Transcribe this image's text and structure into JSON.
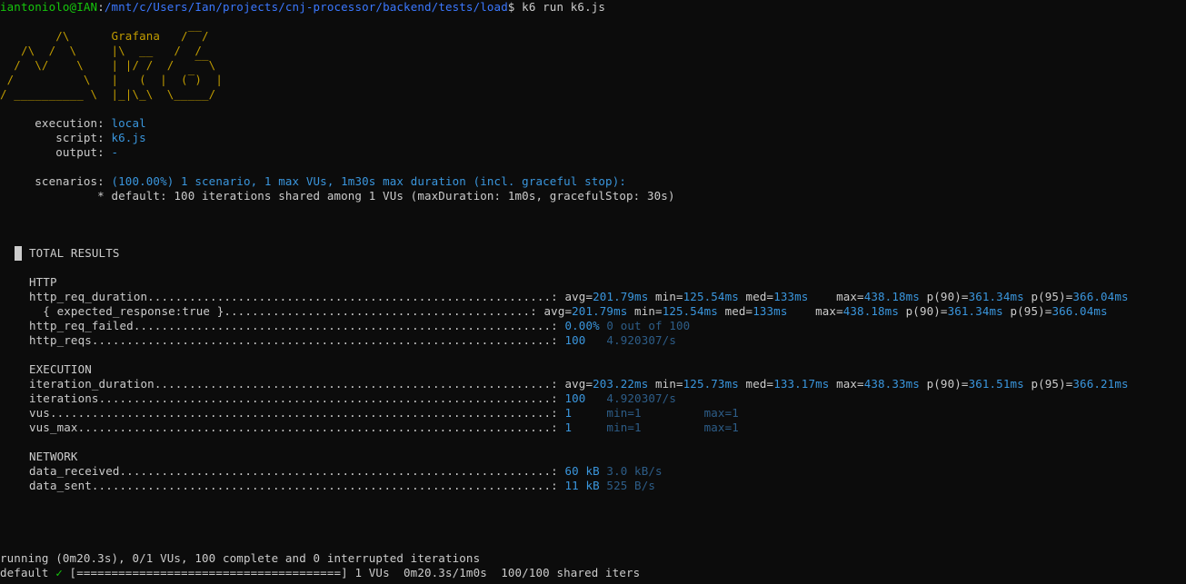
{
  "prompt": {
    "user": "iantoniolo@IAN",
    "colon": ":",
    "path": "/mnt/c/Users/Ian/projects/cnj-processor/backend/tests/load",
    "dollar": "$",
    "command": " k6 run k6.js"
  },
  "logo": {
    "lines": [
      "        /\\      Grafana   /‾‾/  ",
      "   /\\  /  \\     |\\  __   /  /   ",
      "  /  \\/    \\    | |/ /  /   ‾‾\\ ",
      " /          \\   |   (  |  (‾)  |",
      "/ __________ \\  |_|\\_\\  \\_____/ "
    ]
  },
  "config": {
    "execution_label": "     execution: ",
    "execution_value": "local",
    "script_label": "        script: ",
    "script_value": "k6.js",
    "output_label": "        output: ",
    "output_value": "-",
    "scenarios_label": "     scenarios: ",
    "scenarios_value": "(100.00%) 1 scenario, 1 max VUs, 1m30s max duration (incl. graceful stop):",
    "default_line": "              * default: 100 iterations shared among 1 VUs (maxDuration: 1m0s, gracefulStop: 30s)"
  },
  "results": {
    "title": "TOTAL RESULTS",
    "http_header": "HTTP",
    "execution_header": "EXECUTION",
    "network_header": "NETWORK",
    "http_req_duration": {
      "name": "http_req_duration",
      "dots": "..........................................................: ",
      "avg_k": "avg=",
      "avg_v": "201.79ms",
      "min_k": " min=",
      "min_v": "125.54ms",
      "med_k": " med=",
      "med_v": "133ms",
      "max_k": "    max=",
      "max_v": "438.18ms",
      "p90_k": " p(90)=",
      "p90_v": "361.34ms",
      "p95_k": " p(95)=",
      "p95_v": "366.04ms"
    },
    "expected_response": {
      "name": "  { expected_response:true }",
      "dots": "............................................: ",
      "avg_k": "avg=",
      "avg_v": "201.79ms",
      "min_k": " min=",
      "min_v": "125.54ms",
      "med_k": " med=",
      "med_v": "133ms",
      "max_k": "    max=",
      "max_v": "438.18ms",
      "p90_k": " p(90)=",
      "p90_v": "361.34ms",
      "p95_k": " p(95)=",
      "p95_v": "366.04ms"
    },
    "http_req_failed": {
      "name": "http_req_failed",
      "dots": "............................................................: ",
      "value": "0.00%",
      "extra": " 0 out of 100"
    },
    "http_reqs": {
      "name": "http_reqs",
      "dots": "..................................................................: ",
      "value": "100",
      "extra": "   4.920307/s"
    },
    "iteration_duration": {
      "name": "iteration_duration",
      "dots": ".........................................................: ",
      "avg_k": "avg=",
      "avg_v": "203.22ms",
      "min_k": " min=",
      "min_v": "125.73ms",
      "med_k": " med=",
      "med_v": "133.17ms",
      "max_k": " max=",
      "max_v": "438.33ms",
      "p90_k": " p(90)=",
      "p90_v": "361.51ms",
      "p95_k": " p(95)=",
      "p95_v": "366.21ms"
    },
    "iterations": {
      "name": "iterations",
      "dots": ".................................................................: ",
      "value": "100",
      "extra": "   4.920307/s"
    },
    "vus": {
      "name": "vus",
      "dots": "........................................................................: ",
      "value": "1",
      "extra": "     min=1         max=1"
    },
    "vus_max": {
      "name": "vus_max",
      "dots": "....................................................................: ",
      "value": "1",
      "extra": "     min=1         max=1"
    },
    "data_received": {
      "name": "data_received",
      "dots": "..............................................................: ",
      "value": "60 kB",
      "extra": " 3.0 kB/s"
    },
    "data_sent": {
      "name": "data_sent",
      "dots": "..................................................................: ",
      "value": "11 kB",
      "extra": " 525 B/s"
    }
  },
  "status": {
    "running": "running (0m20.3s), 0/1 VUs, 100 complete and 0 interrupted iterations",
    "default_label": "default ",
    "check": "✓",
    "bar": " [======================================] 1 VUs  0m20.3s/1m0s  100/100 shared iters"
  }
}
